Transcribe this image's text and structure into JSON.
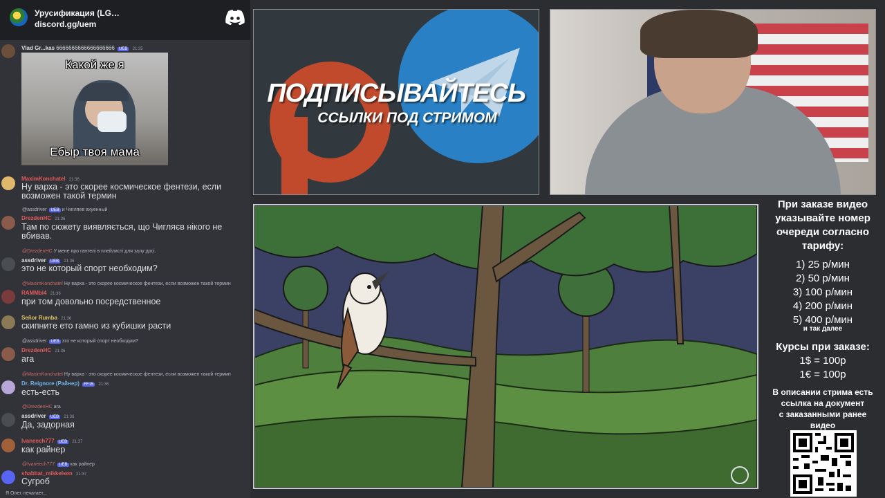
{
  "server": {
    "name": "Урусификация (LG…",
    "invite": "discord.gg/uem",
    "icon": "discord-logo"
  },
  "messages": [
    {
      "user": "Vlad Gr...kas",
      "tail": "6666666666666666666",
      "badge": "UEB",
      "time": "21:35",
      "color": "#e0e0e0"
    },
    {
      "user": "MaximKonchatel",
      "time": "21:36",
      "color": "#e45b5b",
      "text": "Ну варха - это скорее космическое фентези, если возможен такой термин"
    },
    {
      "reply_user": "@assdriver",
      "reply_badge": "UEB",
      "reply_text": "и Чигляев ахуенный",
      "user": "DrezdenHC",
      "time": "21:36",
      "color": "#e45b5b",
      "text": "Там по сюжету виявляється, що Чигляєв нікого не вбивав."
    },
    {
      "reply_user": "@DrezdenHC",
      "reply_text": "У мене про гантелі в плейлисті для залу досі.",
      "user": "assdriver",
      "badge": "UEB",
      "time": "21:36",
      "color": "#e0e0e0",
      "text": "это не который спорт необходим?"
    },
    {
      "reply_user": "@MaximKonchatel",
      "reply_text": "Ну варха - это скорее космическое фентези, если возможен такой термин",
      "user": "RAMMbl4",
      "time": "21:36",
      "color": "#e45b5b",
      "text": "при том довольно посредственное"
    },
    {
      "user": "Señor Rumba",
      "time": "21:36",
      "color": "#e0c46b",
      "text": "скипните ето гамно из кубишки расти"
    },
    {
      "reply_user": "@assdriver",
      "reply_badge": "UEB",
      "reply_text": "это не который спорт необходим?",
      "user": "DrezdenHC",
      "time": "21:36",
      "color": "#e45b5b",
      "text": "ага"
    },
    {
      "reply_user": "@MaximKonchatel",
      "reply_text": "Ну варха - это скорее космическое фентези, если возможен такой термин",
      "user": "Dr. Reignore (Райнер)",
      "badge": "FF15",
      "time": "21:36",
      "color": "#6fb4e8",
      "text": "есть-есть"
    },
    {
      "reply_user": "@DrezdenHC",
      "reply_text": "ага",
      "user": "assdriver",
      "badge": "UEB",
      "time": "21:36",
      "color": "#e0e0e0",
      "text": "Да, задорная"
    },
    {
      "user": "Ivaneech777",
      "badge": "UEB",
      "time": "21:37",
      "color": "#e45b5b",
      "text": "как райнер"
    },
    {
      "reply_user": "@Ivaneech777",
      "reply_badge": "UEB",
      "reply_text": "как райнер",
      "user": "shabbat_mikkelsen",
      "time": "21:37",
      "color": "#e45b5b",
      "text": "Сугроб"
    }
  ],
  "meme": {
    "top": "Какой же я",
    "bottom": "Ебыр твоя мама"
  },
  "typing": "Я Олег. печатает...",
  "banner": {
    "title": "ПОДПИСЫВАЙТЕСЬ",
    "subtitle": "ССЫЛКИ ПОД СТРИМОМ"
  },
  "info": {
    "header": [
      "При заказе видео",
      "указывайте номер",
      "очереди согласно",
      "тарифу:"
    ],
    "tariffs": [
      "1) 25 р/мин",
      "2) 50 р/мин",
      "3) 100 р/мин",
      "4) 200 р/мин",
      "5) 400 р/мин"
    ],
    "etc": "и так далее",
    "rates_title": "Курсы при заказе:",
    "rates": [
      "1$ = 100р",
      "1€ = 100р"
    ],
    "footer": [
      "В описании стрима есть",
      "ссылка на документ",
      "с заказанными ранее",
      "видео"
    ]
  },
  "colors": {
    "chat_bg": "#313338",
    "header_bg": "#1e1f22",
    "stream_bg": "#2b2d31",
    "patreon": "#c14a2d",
    "telegram": "#2a80c4"
  }
}
